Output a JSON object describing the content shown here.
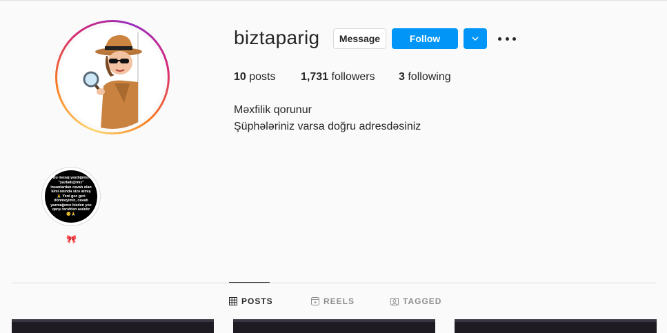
{
  "profile": {
    "username": "biztaparig",
    "buttons": {
      "message": "Message",
      "follow": "Follow"
    },
    "stats": {
      "posts_count": "10",
      "posts_label": "posts",
      "followers_count": "1,731",
      "followers_label": "followers",
      "following_count": "3",
      "following_label": "following"
    },
    "bio": [
      "Məxfilik qorunur",
      "Şüphələriniz varsa doğru adresdəsiniz"
    ]
  },
  "highlight": {
    "text": "Bu mesaj yazdığımız \"yazladı@mız\" insanlardan cavab olan kimi onında sizə atmış 🙏 Yeni gec geri dönmeyimiz, cavab yazmağımız bizden yox qarşı tərəfdən asılıdır🙂🙏",
    "label": "🎀"
  },
  "tabs": [
    {
      "label": "POSTS",
      "icon": "grid-icon",
      "active": true
    },
    {
      "label": "REELS",
      "icon": "reels-icon",
      "active": false
    },
    {
      "label": "TAGGED",
      "icon": "tagged-icon",
      "active": false
    }
  ],
  "colors": {
    "follow_blue": "#0095f6",
    "text": "#262626",
    "muted": "#8e8e8e",
    "border": "#dbdbdb"
  }
}
